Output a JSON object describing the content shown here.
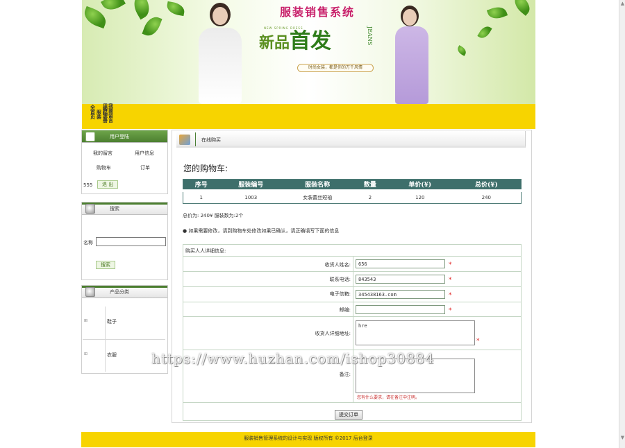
{
  "banner": {
    "title": "服装销售系统",
    "sub": "NEW SPRING DRESS",
    "main_pre": "新品",
    "main": "首发",
    "jeans": "JEANS",
    "slogan": "时尚女装，都是你的万千风情"
  },
  "nav": {
    "items": [
      "全首页",
      "服装",
      "购物车",
      "用户注册",
      "我要留言"
    ]
  },
  "sidebar": {
    "user_panel": {
      "title": "用户登陆",
      "links": [
        "我的留言",
        "用户信息",
        "购物车",
        "订单"
      ],
      "username": "555",
      "logout": "退 出"
    },
    "search_panel": {
      "title": "搜索",
      "name_label": "名称",
      "search_button": "搜索"
    },
    "category_panel": {
      "title": "产品分类",
      "categories": [
        "鞋子",
        "衣服"
      ]
    }
  },
  "main": {
    "tab_label": "在线购买",
    "cart_title": "您的购物车:",
    "columns": [
      "序号",
      "服装编号",
      "服装名称",
      "数量",
      "单价(¥)",
      "总价(¥)"
    ],
    "rows": [
      [
        "1",
        "1003",
        "女装蕾丝短袖",
        "2",
        "120",
        "240"
      ]
    ],
    "summary": "总价为:  240¥  服装数为:2个",
    "note": "如果需要修改，请到购物车处修改如果已确认，请正确填写下面的信息",
    "order": {
      "head": "购买人人详细信息:",
      "name_label": "收货人姓名:",
      "name_value": "656",
      "phone_label": "联系电话:",
      "phone_value": "843543",
      "email_label": "电子信箱:",
      "email_value": "345438163.com",
      "zip_label": "邮编:",
      "zip_value": "",
      "address_label": "收货人详细地址:",
      "address_value": "hre",
      "remark_label": "备注:",
      "remark_value": "",
      "remark_hint": "您有什么要求，请在备注中注明。",
      "submit": "提交订单"
    }
  },
  "footer": "服装销售管理系统的设计与实现   版权所有  ©2017  后台登录",
  "watermark": "https://www.huzhan.com/ishop30884"
}
